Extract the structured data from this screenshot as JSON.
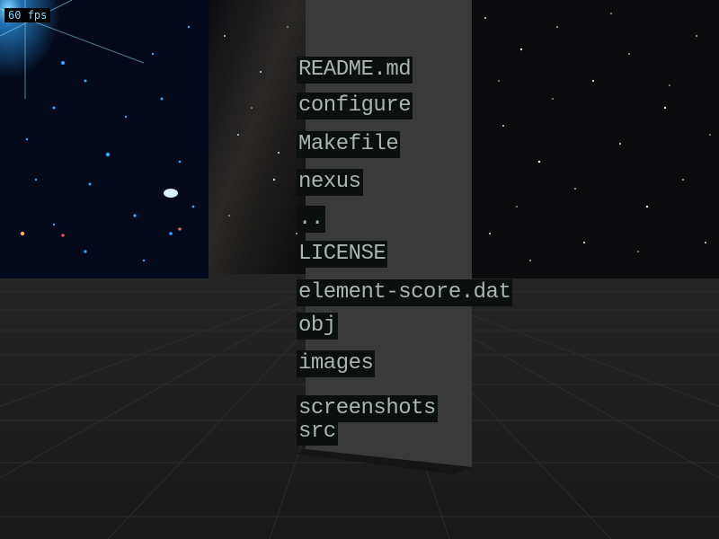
{
  "hud": {
    "fps_label": "60 fps"
  },
  "files": [
    "README.md",
    "configure",
    "Makefile",
    "nexus",
    "..",
    "LICENSE",
    "element-score.dat",
    "obj",
    "images",
    "screenshots",
    "src"
  ],
  "colors": {
    "floor": "#1d1d1d",
    "grid": "#2c2c2c",
    "pillar": "#3b3b3b",
    "label_bg": "#0b0f0e",
    "label_text": "#a9b5b0",
    "fps_text": "#8fd6ff"
  }
}
